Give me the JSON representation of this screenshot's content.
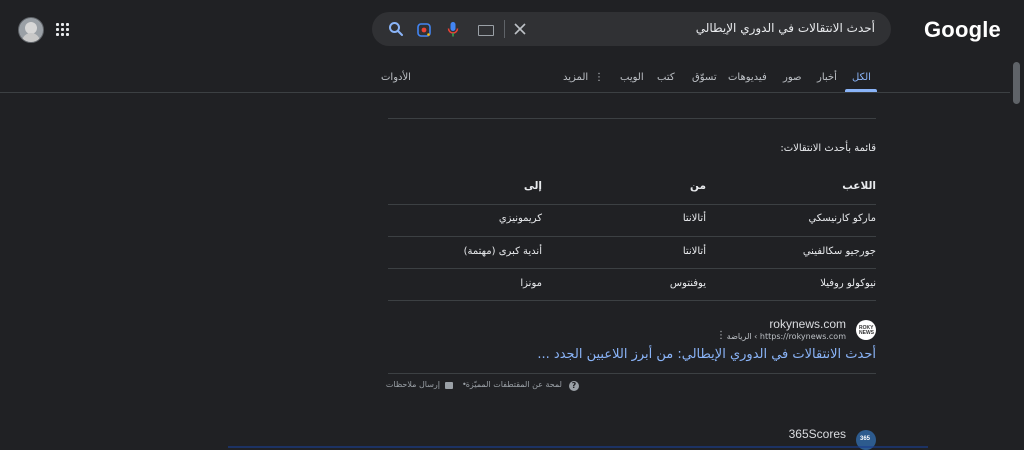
{
  "logo": "Google",
  "search": {
    "query": "أحدث الانتقالات في الدوري الإيطالي",
    "clear_label": "×"
  },
  "tabs": [
    {
      "label": "الكل",
      "active": true
    },
    {
      "label": "أخبار"
    },
    {
      "label": "صور"
    },
    {
      "label": "فيديوهات"
    },
    {
      "label": "تسوّق"
    },
    {
      "label": "كتب"
    },
    {
      "label": "الويب"
    },
    {
      "label": "المزيد"
    }
  ],
  "tools_label": "الأدوات",
  "list_title": "قائمة بأحدث الانتقالات:",
  "table": {
    "headers": [
      "اللاعب",
      "من",
      "إلى"
    ],
    "rows": [
      [
        "ماركو كارنيسكي",
        "أتالانتا",
        "كريمونيزي"
      ],
      [
        "جورجيو سكالفيني",
        "أتالانتا",
        "أندية كبرى (مهتمة)"
      ],
      [
        "نيوكولو روفيلا",
        "يوفنتوس",
        "مونزا"
      ]
    ]
  },
  "result": {
    "favicon_text": "ROKY NEWS",
    "site_name": "rokynews.com",
    "url": "https://rokynews.com › الرياضة",
    "title": "أحدث الانتقالات في الدوري الإيطالي: من أبرز اللاعبين الجدد ..."
  },
  "footer": {
    "about": "لمحة عن المقتطفات المميّزة",
    "feedback": "إرسال ملاحظات"
  },
  "result2": {
    "site_name": "365Scores",
    "favicon_text": "365"
  },
  "colors": {
    "background": "#202124",
    "link": "#8ab4f8",
    "searchbox": "#303134"
  }
}
